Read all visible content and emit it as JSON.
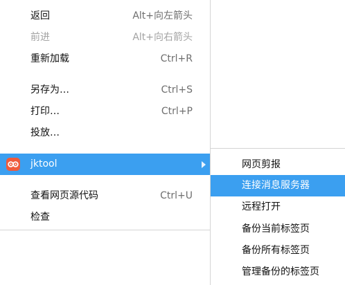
{
  "context_menu": {
    "items": [
      {
        "label": "返回",
        "shortcut": "Alt+向左箭头",
        "enabled": true
      },
      {
        "label": "前进",
        "shortcut": "Alt+向右箭头",
        "enabled": false
      },
      {
        "label": "重新加载",
        "shortcut": "Ctrl+R",
        "enabled": true
      },
      {
        "label": "另存为…",
        "shortcut": "Ctrl+S",
        "enabled": true
      },
      {
        "label": "打印…",
        "shortcut": "Ctrl+P",
        "enabled": true
      },
      {
        "label": "投放…",
        "shortcut": "",
        "enabled": true
      },
      {
        "label": "jktool",
        "icon": "jktool-extension-icon",
        "submenu_arrow": "chevron-right-icon",
        "highlighted": true
      },
      {
        "label": "查看网页源代码",
        "shortcut": "Ctrl+U",
        "enabled": true
      },
      {
        "label": "检查",
        "shortcut": "",
        "enabled": true
      }
    ]
  },
  "submenu": {
    "items": [
      {
        "label": "网页剪报"
      },
      {
        "label": "连接消息服务器",
        "highlighted": true
      },
      {
        "label": "远程打开"
      },
      {
        "label": "备份当前标签页"
      },
      {
        "label": "备份所有标签页"
      },
      {
        "label": "管理备份的标签页"
      }
    ]
  },
  "colors": {
    "highlight": "#3b9ff0",
    "extension_icon": "#ef5a3c",
    "disabled_text": "#a3a3a3",
    "shortcut_text": "#6e6e6e"
  }
}
